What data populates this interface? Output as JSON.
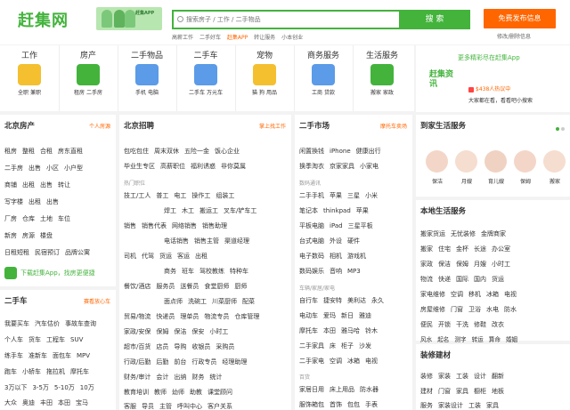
{
  "header": {
    "logo": "赶集网",
    "banner_text": "赶集APP",
    "search": {
      "placeholder": "搜索房子 / 工作 / 二手物品",
      "button": "搜 索"
    },
    "hot_links": [
      "高薪工作",
      "二手好车",
      "赶集APP",
      "转让服务",
      "小本创业"
    ],
    "post_button": "免费发布信息",
    "edit_link": "修改/删除信息"
  },
  "nav": {
    "categories": [
      {
        "title": "工作",
        "subs": [
          "全职",
          "兼职"
        ],
        "color": "#f4b400"
      },
      {
        "title": "房产",
        "subs": [
          "租房",
          "二手房"
        ],
        "color": "#43b33c"
      },
      {
        "title": "二手物品",
        "subs": [
          "手机",
          "电脑"
        ],
        "color": "#4a90e2"
      },
      {
        "title": "二手车",
        "subs": [
          "二手车",
          "万元车"
        ],
        "color": "#4a90e2"
      },
      {
        "title": "宠物",
        "subs": [
          "猫",
          "狗",
          "用品"
        ],
        "color": "#f4b400"
      },
      {
        "title": "商务服务",
        "subs": [
          "工商",
          "贷款"
        ],
        "color": "#4a90e2"
      },
      {
        "title": "生活服务",
        "subs": [
          "搬家",
          "家政"
        ],
        "color": "#43b33c"
      }
    ]
  },
  "app_promo": {
    "heading": "更多精彩尽在赶集App",
    "badge": "赶集资讯",
    "line1": "$438人热议中",
    "line2": "大家都在看，看看吧小搜索"
  },
  "housing": {
    "title": "北京房产",
    "more": "个人房源",
    "lines": [
      [
        "租房",
        "整租",
        "合租",
        "房东直租"
      ],
      [
        "二手房",
        "出售",
        "小区",
        "小户型"
      ],
      [
        "商铺",
        "出租",
        "出售",
        "转让"
      ],
      [
        "写字楼",
        "出租",
        "出售"
      ],
      [
        "厂房",
        "仓库",
        "土地",
        "车位"
      ],
      [
        "新房",
        "房源",
        "楼盘"
      ],
      [
        "日租短租",
        "民宿预订",
        "品牌公寓"
      ]
    ],
    "download": "下载赶集App，找房更便捷"
  },
  "car": {
    "title": "二手车",
    "more": "赛看放心车",
    "lines": [
      [
        "我要买车",
        "汽车估价",
        "事故车查询"
      ],
      [
        "个人车",
        "货车",
        "工程车",
        "SUV"
      ],
      [
        "练手车",
        "准新车",
        "面包车",
        "MPV"
      ],
      [
        "跑车",
        "小轿车",
        "拖拉机",
        "摩托车"
      ],
      [
        "3万以下",
        "3-5万",
        "5-10万",
        "10万"
      ],
      [
        "大众",
        "奥迪",
        "丰田",
        "本田",
        "宝马"
      ]
    ]
  },
  "jobs": {
    "title": "北京招聘",
    "more": "掌上找工作",
    "lines": [
      [
        "包吃包住",
        "周末双休",
        "五险一金",
        "饭心企业"
      ],
      [
        "毕业生专区",
        "高薪职位",
        "福利诱惑",
        "非你莫属"
      ],
      [
        "热门职位"
      ],
      [
        "技工/工人",
        "普工",
        "电工",
        "操作工",
        "组装工"
      ],
      [
        "焊工",
        "木工",
        "搬运工",
        "叉车/铲车工"
      ],
      [
        "销售",
        "销售代表",
        "网络销售",
        "销售助理"
      ],
      [
        "电话销售",
        "销售主管",
        "渠道经理"
      ],
      [
        "司机",
        "代驾",
        "货运",
        "客运",
        "出租"
      ],
      [
        "商务",
        "班车",
        "驾校教练",
        "特种车"
      ],
      [
        "餐饮/酒店",
        "服务员",
        "送餐员",
        "食堂厨师",
        "厨师"
      ],
      [
        "面点师",
        "洗碗工",
        "川菜厨师",
        "配菜"
      ],
      [
        "贸易/物流",
        "快递员",
        "理单员",
        "物流专员",
        "仓库管理"
      ],
      [
        "家政/安保",
        "保姆",
        "保洁",
        "保安",
        "小时工"
      ],
      [
        "超市/百货",
        "店员",
        "导购",
        "收银员",
        "采购员"
      ],
      [
        "行政/后勤",
        "后勤",
        "前台",
        "行政专员",
        "经理助理"
      ],
      [
        "财务/审计",
        "会计",
        "出纳",
        "财务",
        "统计"
      ],
      [
        "教育培训",
        "教师",
        "幼师",
        "助教",
        "课堂顾问"
      ],
      [
        "客服",
        "导员",
        "主管",
        "呼叫中心",
        "客户关系"
      ]
    ]
  },
  "market": {
    "title": "二手市场",
    "more": "摩托车卖场",
    "lines": [
      [
        "闲置換钱",
        "iPhone",
        "健康出行"
      ],
      [
        "换季淘衣",
        "京家家具",
        "小家电"
      ],
      [
        "数码通讯"
      ],
      [
        "二手手机",
        "苹果",
        "三星",
        "小米"
      ],
      [
        "笔记本",
        "thinkpad",
        "苹果"
      ],
      [
        "平板电脑",
        "iPad",
        "三星平板"
      ],
      [
        "台式电脑",
        "外设",
        "硬件"
      ],
      [
        "电子数码",
        "相机",
        "游戏机"
      ],
      [
        "数码娱乐",
        "音响",
        "MP3"
      ],
      [
        "车辆/家居/家电"
      ],
      [
        "自行车",
        "捷安特",
        "美利达",
        "永久"
      ],
      [
        "电动车",
        "爱玛",
        "新日",
        "雅迪"
      ],
      [
        "摩托车",
        "本田",
        "雅马哈",
        "铃木"
      ],
      [
        "二手家具",
        "床",
        "柜子",
        "沙发"
      ],
      [
        "二手家电",
        "空调",
        "冰箱",
        "电视"
      ],
      [
        "百货"
      ],
      [
        "家居日用",
        "床上用品",
        "防水器"
      ],
      [
        "服饰箱包",
        "首饰",
        "包包",
        "手表"
      ]
    ]
  },
  "city_service": {
    "title": "到家生活服务",
    "items": [
      "保洁",
      "月嫂",
      "育儿嫂",
      "保姆",
      "搬家"
    ]
  },
  "local_life": {
    "title": "本地生活服务",
    "lines": [
      [
        "搬家货运",
        "无忧装修",
        "金牌商家"
      ],
      [
        "搬家",
        "住宅",
        "金杯",
        "长途",
        "办公室"
      ],
      [
        "家政",
        "保洁",
        "保姆",
        "月嫂",
        "小时工"
      ],
      [
        "物流",
        "快递",
        "国际",
        "国内",
        "货运"
      ],
      [
        "家电维修",
        "空调",
        "移机",
        "冰箱",
        "电视"
      ],
      [
        "房屋维修",
        "门窗",
        "卫浴",
        "水电",
        "防水"
      ],
      [
        "便民",
        "开锁",
        "干洗",
        "修鞋",
        "改衣"
      ],
      [
        "风水",
        "起名",
        "测字",
        "转运",
        "算命",
        "婚姻"
      ]
    ]
  },
  "decor": {
    "title": "装修建材",
    "lines": [
      [
        "装修",
        "家装",
        "工装",
        "设计",
        "翻新"
      ],
      [
        "建材",
        "门窗",
        "家具",
        "橱柜",
        "地板"
      ],
      [
        "服务",
        "家装设计",
        "工装",
        "家具"
      ]
    ]
  }
}
